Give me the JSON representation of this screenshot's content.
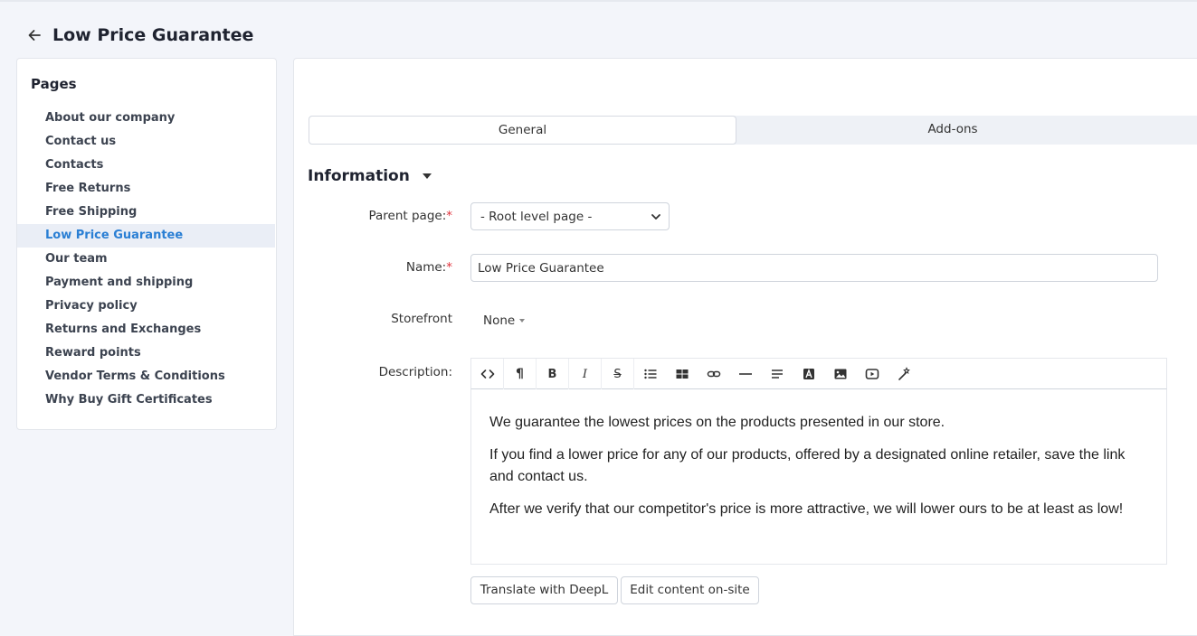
{
  "header": {
    "title": "Low Price Guarantee"
  },
  "sidebar": {
    "title": "Pages",
    "items": [
      {
        "label": "About our company"
      },
      {
        "label": "Contact us"
      },
      {
        "label": "Contacts"
      },
      {
        "label": "Free Returns"
      },
      {
        "label": "Free Shipping"
      },
      {
        "label": "Low Price Guarantee"
      },
      {
        "label": "Our team"
      },
      {
        "label": "Payment and shipping"
      },
      {
        "label": "Privacy policy"
      },
      {
        "label": "Returns and Exchanges"
      },
      {
        "label": "Reward points"
      },
      {
        "label": "Vendor Terms & Conditions"
      },
      {
        "label": "Why Buy Gift Certificates"
      }
    ],
    "active_item": "Low Price Guarantee"
  },
  "tabs": [
    {
      "label": "General",
      "active": true
    },
    {
      "label": "Add-ons",
      "active": false
    }
  ],
  "section": {
    "title": "Information"
  },
  "form": {
    "parent_page": {
      "label": "Parent page:",
      "required_mark": "*",
      "value": "- Root level page -"
    },
    "name": {
      "label": "Name:",
      "required_mark": "*",
      "value": "Low Price Guarantee"
    },
    "storefront": {
      "label": "Storefront",
      "value": "None"
    },
    "description": {
      "label": "Description:",
      "toolbar": [
        "code-view-icon",
        "paragraph-icon",
        "bold-icon",
        "italic-icon",
        "strikethrough-icon",
        "unordered-list-icon",
        "table-icon",
        "link-icon",
        "horizontal-rule-icon",
        "align-icon",
        "text-color-icon",
        "image-icon",
        "video-icon",
        "magic-wand-icon"
      ],
      "paragraphs": [
        "We guarantee the lowest prices on the products presented in our store.",
        "If you find a lower price for any of our products, offered by a designated online retailer, save the link and contact us.",
        "After we verify that our competitor's price is more attractive, we will lower ours to be at least as low!"
      ]
    }
  },
  "buttons": {
    "translate": "Translate with DeepL",
    "edit_onsite": "Edit content on-site"
  },
  "colors": {
    "accent": "#2a7fd4",
    "required": "#e0323c",
    "background": "#f3f5fa"
  }
}
